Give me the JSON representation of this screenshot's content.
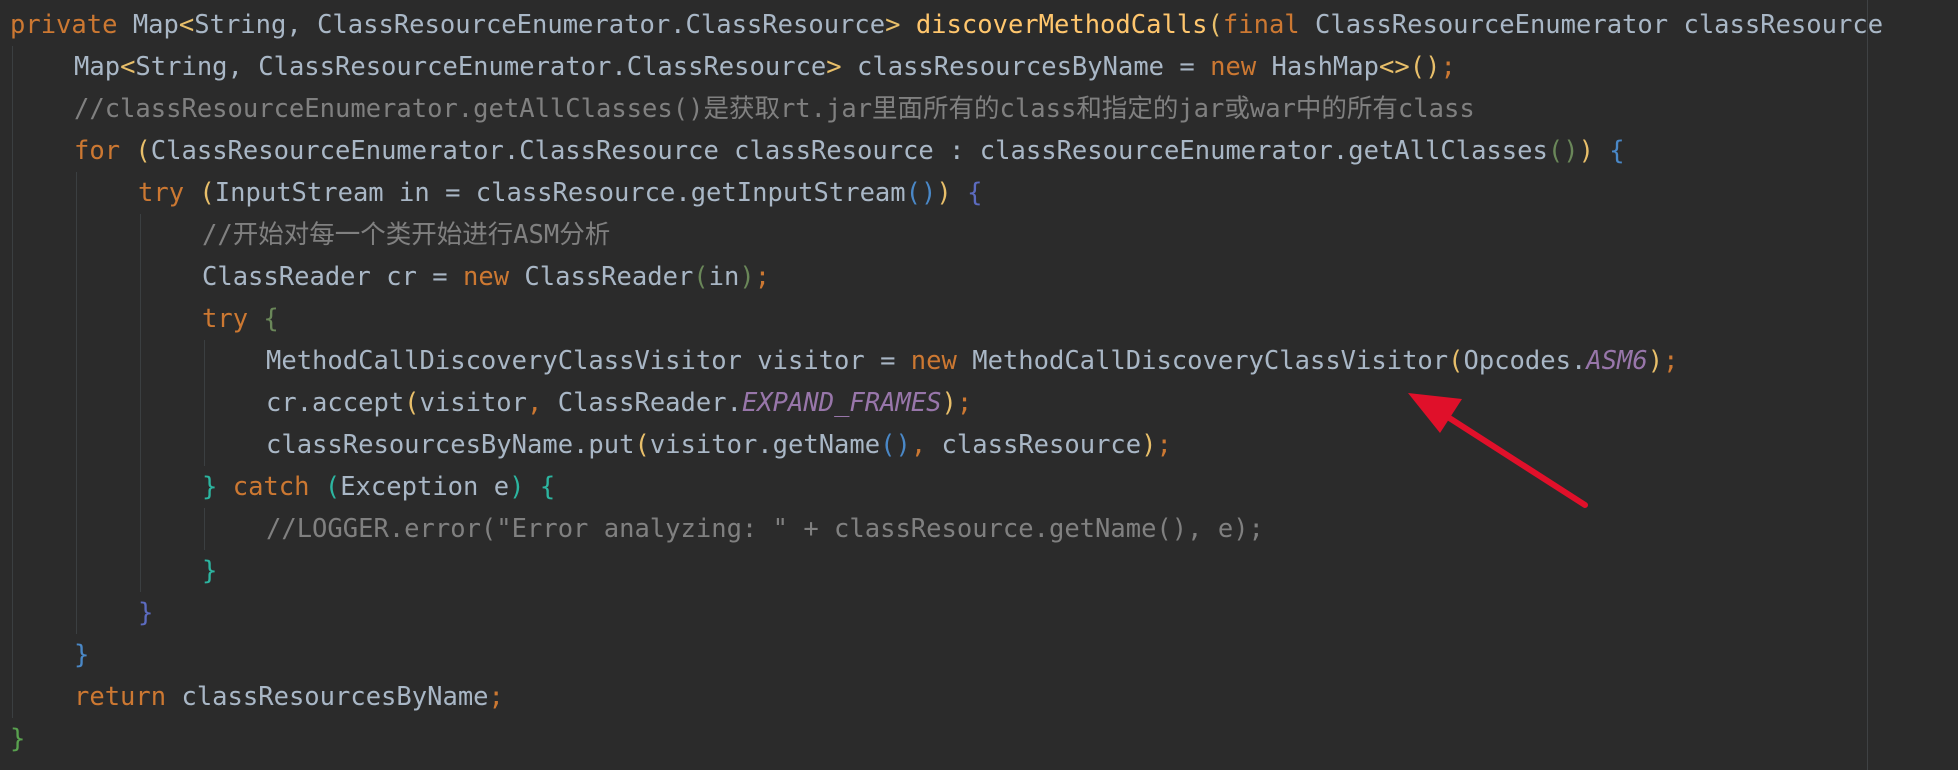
{
  "editor": {
    "language": "Java",
    "colors": {
      "background": "#2b2b2b",
      "keyword": "#cc7832",
      "method_declaration": "#ffc66d",
      "comment": "#808080",
      "static_constant": "#9876aa",
      "plain": "#a9b7c6",
      "annotation_arrow": "#e0102a"
    },
    "lines": [
      {
        "indent": 0,
        "tokens": [
          {
            "t": "private",
            "c": "kw"
          },
          {
            "t": " ",
            "c": "pl"
          },
          {
            "t": "Map",
            "c": "pl"
          },
          {
            "t": "<",
            "c": "b1"
          },
          {
            "t": "String, ClassResourceEnumerator.ClassResource",
            "c": "pl"
          },
          {
            "t": ">",
            "c": "b1"
          },
          {
            "t": " ",
            "c": "pl"
          },
          {
            "t": "discoverMethodCalls",
            "c": "fn"
          },
          {
            "t": "(",
            "c": "b1"
          },
          {
            "t": "final",
            "c": "kw"
          },
          {
            "t": " ClassResourceEnumerator classResource",
            "c": "pl"
          }
        ]
      },
      {
        "indent": 1,
        "tokens": [
          {
            "t": "Map",
            "c": "pl"
          },
          {
            "t": "<",
            "c": "b1"
          },
          {
            "t": "String, ClassResourceEnumerator.ClassResource",
            "c": "pl"
          },
          {
            "t": ">",
            "c": "b1"
          },
          {
            "t": " classResourcesByName = ",
            "c": "pl"
          },
          {
            "t": "new",
            "c": "kw"
          },
          {
            "t": " HashMap",
            "c": "pl"
          },
          {
            "t": "<>",
            "c": "b1"
          },
          {
            "t": "()",
            "c": "b1"
          },
          {
            "t": ";",
            "c": "kw"
          }
        ]
      },
      {
        "indent": 1,
        "tokens": [
          {
            "t": "//classResourceEnumerator.getAllClasses()是获取rt.jar里面所有的class和指定的jar或war中的所有class",
            "c": "cmt"
          }
        ]
      },
      {
        "indent": 1,
        "tokens": [
          {
            "t": "for",
            "c": "kw"
          },
          {
            "t": " ",
            "c": "pl"
          },
          {
            "t": "(",
            "c": "b1"
          },
          {
            "t": "ClassResourceEnumerator.ClassResource classResource : classResourceEnumerator.getAllClasses",
            "c": "pl"
          },
          {
            "t": "()",
            "c": "b2"
          },
          {
            "t": ")",
            "c": "b1"
          },
          {
            "t": " ",
            "c": "pl"
          },
          {
            "t": "{",
            "c": "b3"
          }
        ]
      },
      {
        "indent": 2,
        "tokens": [
          {
            "t": "try",
            "c": "kw"
          },
          {
            "t": " ",
            "c": "pl"
          },
          {
            "t": "(",
            "c": "b1"
          },
          {
            "t": "InputStream in = classResource.getInputStream",
            "c": "pl"
          },
          {
            "t": "()",
            "c": "b3"
          },
          {
            "t": ")",
            "c": "b1"
          },
          {
            "t": " ",
            "c": "pl"
          },
          {
            "t": "{",
            "c": "b5"
          }
        ]
      },
      {
        "indent": 3,
        "tokens": [
          {
            "t": "//开始对每一个类开始进行ASM分析",
            "c": "cmt"
          }
        ]
      },
      {
        "indent": 3,
        "tokens": [
          {
            "t": "ClassReader cr = ",
            "c": "pl"
          },
          {
            "t": "new",
            "c": "kw"
          },
          {
            "t": " ClassReader",
            "c": "pl"
          },
          {
            "t": "(",
            "c": "b2"
          },
          {
            "t": "in",
            "c": "pl"
          },
          {
            "t": ")",
            "c": "b2"
          },
          {
            "t": ";",
            "c": "kw"
          }
        ]
      },
      {
        "indent": 3,
        "tokens": [
          {
            "t": "try",
            "c": "kw"
          },
          {
            "t": " ",
            "c": "pl"
          },
          {
            "t": "{",
            "c": "b2"
          }
        ]
      },
      {
        "indent": 4,
        "tokens": [
          {
            "t": "MethodCallDiscoveryClassVisitor visitor = ",
            "c": "pl"
          },
          {
            "t": "new",
            "c": "kw"
          },
          {
            "t": " MethodCallDiscoveryClassVisitor",
            "c": "pl"
          },
          {
            "t": "(",
            "c": "b1"
          },
          {
            "t": "Opcodes.",
            "c": "pl"
          },
          {
            "t": "ASM6",
            "c": "cst"
          },
          {
            "t": ")",
            "c": "b1"
          },
          {
            "t": ";",
            "c": "kw"
          }
        ]
      },
      {
        "indent": 4,
        "tokens": [
          {
            "t": "cr.accept",
            "c": "pl"
          },
          {
            "t": "(",
            "c": "b1"
          },
          {
            "t": "visitor",
            "c": "pl"
          },
          {
            "t": ",",
            "c": "kw"
          },
          {
            "t": " ClassReader.",
            "c": "pl"
          },
          {
            "t": "EXPAND_FRAMES",
            "c": "cst"
          },
          {
            "t": ")",
            "c": "b1"
          },
          {
            "t": ";",
            "c": "kw"
          }
        ]
      },
      {
        "indent": 4,
        "tokens": [
          {
            "t": "classResourcesByName.put",
            "c": "pl"
          },
          {
            "t": "(",
            "c": "b1"
          },
          {
            "t": "visitor.getName",
            "c": "pl"
          },
          {
            "t": "()",
            "c": "b3"
          },
          {
            "t": ",",
            "c": "kw"
          },
          {
            "t": " classResource",
            "c": "pl"
          },
          {
            "t": ")",
            "c": "b1"
          },
          {
            "t": ";",
            "c": "kw"
          }
        ]
      },
      {
        "indent": 3,
        "tokens": [
          {
            "t": "}",
            "c": "b4"
          },
          {
            "t": " ",
            "c": "pl"
          },
          {
            "t": "catch",
            "c": "kw"
          },
          {
            "t": " ",
            "c": "pl"
          },
          {
            "t": "(",
            "c": "b4"
          },
          {
            "t": "Exception e",
            "c": "pl"
          },
          {
            "t": ")",
            "c": "b4"
          },
          {
            "t": " ",
            "c": "pl"
          },
          {
            "t": "{",
            "c": "b4"
          }
        ]
      },
      {
        "indent": 4,
        "tokens": [
          {
            "t": "//LOGGER.error(\"Error analyzing: \" + classResource.getName(), e);",
            "c": "cmt"
          }
        ]
      },
      {
        "indent": 3,
        "tokens": [
          {
            "t": "}",
            "c": "b4"
          }
        ]
      },
      {
        "indent": 2,
        "tokens": [
          {
            "t": "}",
            "c": "b5"
          }
        ]
      },
      {
        "indent": 1,
        "tokens": [
          {
            "t": "}",
            "c": "b3"
          }
        ]
      },
      {
        "indent": 1,
        "tokens": [
          {
            "t": "return",
            "c": "kw"
          },
          {
            "t": " classResourcesByName",
            "c": "pl"
          },
          {
            "t": ";",
            "c": "kw"
          }
        ]
      },
      {
        "indent": 0,
        "tokens": [
          {
            "t": "}",
            "c": "b6"
          }
        ]
      }
    ]
  }
}
